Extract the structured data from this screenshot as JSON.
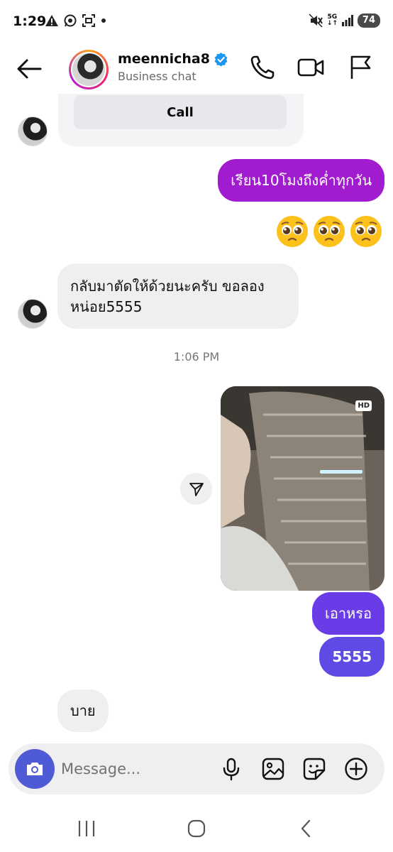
{
  "status_bar": {
    "time": "1:29",
    "network": "5G",
    "battery": "74"
  },
  "header": {
    "contact_name": "meennicha8",
    "subtitle": "Business chat",
    "icons": [
      "back-arrow-icon",
      "phone-icon",
      "video-icon",
      "flag-icon"
    ]
  },
  "messages": {
    "call_card_button": "Call",
    "out_1": "เรียน10โมงถึงค่ำทุกวัน",
    "emoji": "🥺🥺🥺",
    "in_1_line1": "กลับมาตัดให้ด้วยนะครับ ขอลอง",
    "in_1_line2": "หน่อย5555",
    "timestamp": "1:06 PM",
    "photo_badge": "HD",
    "out_2": "เอาหรอ",
    "out_3": "5555",
    "in_2": "บาย"
  },
  "composer": {
    "placeholder": "Message..."
  },
  "colors": {
    "bubble_purple": "#a11ccf",
    "bubble_violet_1": "#6a3ce8",
    "bubble_violet_2": "#5f4ae6",
    "camera_blue": "#4f5bd5",
    "verified_blue": "#1c96f0"
  }
}
